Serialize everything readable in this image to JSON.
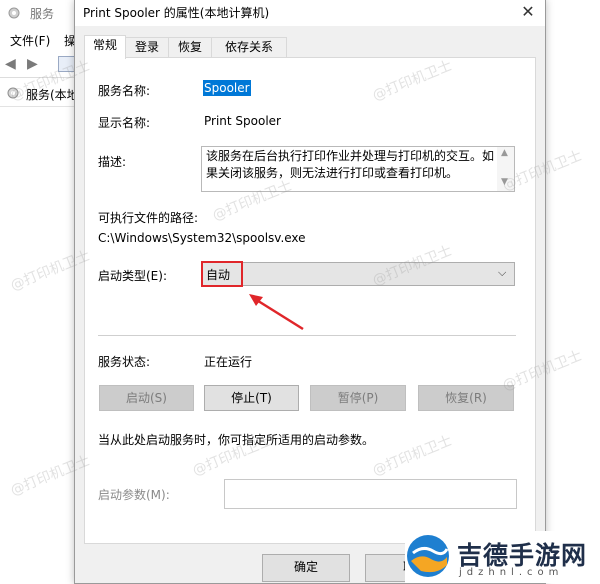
{
  "background_window": {
    "title": "服务",
    "menu": [
      "文件(F)",
      "操"
    ],
    "tree_root": "服务(本地"
  },
  "dialog": {
    "title": "Print Spooler 的属性(本地计算机)",
    "close_glyph": "✕",
    "tabs": [
      "常规",
      "登录",
      "恢复",
      "依存关系"
    ],
    "active_tab": "常规",
    "general": {
      "service_name_label": "服务名称:",
      "service_name": "Spooler",
      "display_name_label": "显示名称:",
      "display_name": "Print Spooler",
      "description_label": "描述:",
      "description": "该服务在后台执行打印作业并处理与打印机的交互。如果关闭该服务，则无法进行打印或查看打印机。",
      "exe_path_label": "可执行文件的路径:",
      "exe_path": "C:\\Windows\\System32\\spoolsv.exe",
      "startup_type_label": "启动类型(E):",
      "startup_type": "自动",
      "service_status_label": "服务状态:",
      "service_status": "正在运行",
      "buttons": {
        "start": "启动(S)",
        "stop": "停止(T)",
        "pause": "暂停(P)",
        "resume": "恢复(R)"
      },
      "hint": "当从此处启动服务时，你可指定所适用的启动参数。",
      "start_params_label": "启动参数(M):",
      "start_params_value": ""
    },
    "footer": {
      "ok": "确定",
      "cancel": "取"
    }
  },
  "annotation": {
    "highlight_color": "#e0262a"
  },
  "watermark": "@打印机卫士",
  "logo": {
    "main": "吉德手游网",
    "sub": "jdzhnl.com"
  },
  "colors": {
    "selection": "#0078d7",
    "dialog_bg": "#f0f0f0"
  }
}
